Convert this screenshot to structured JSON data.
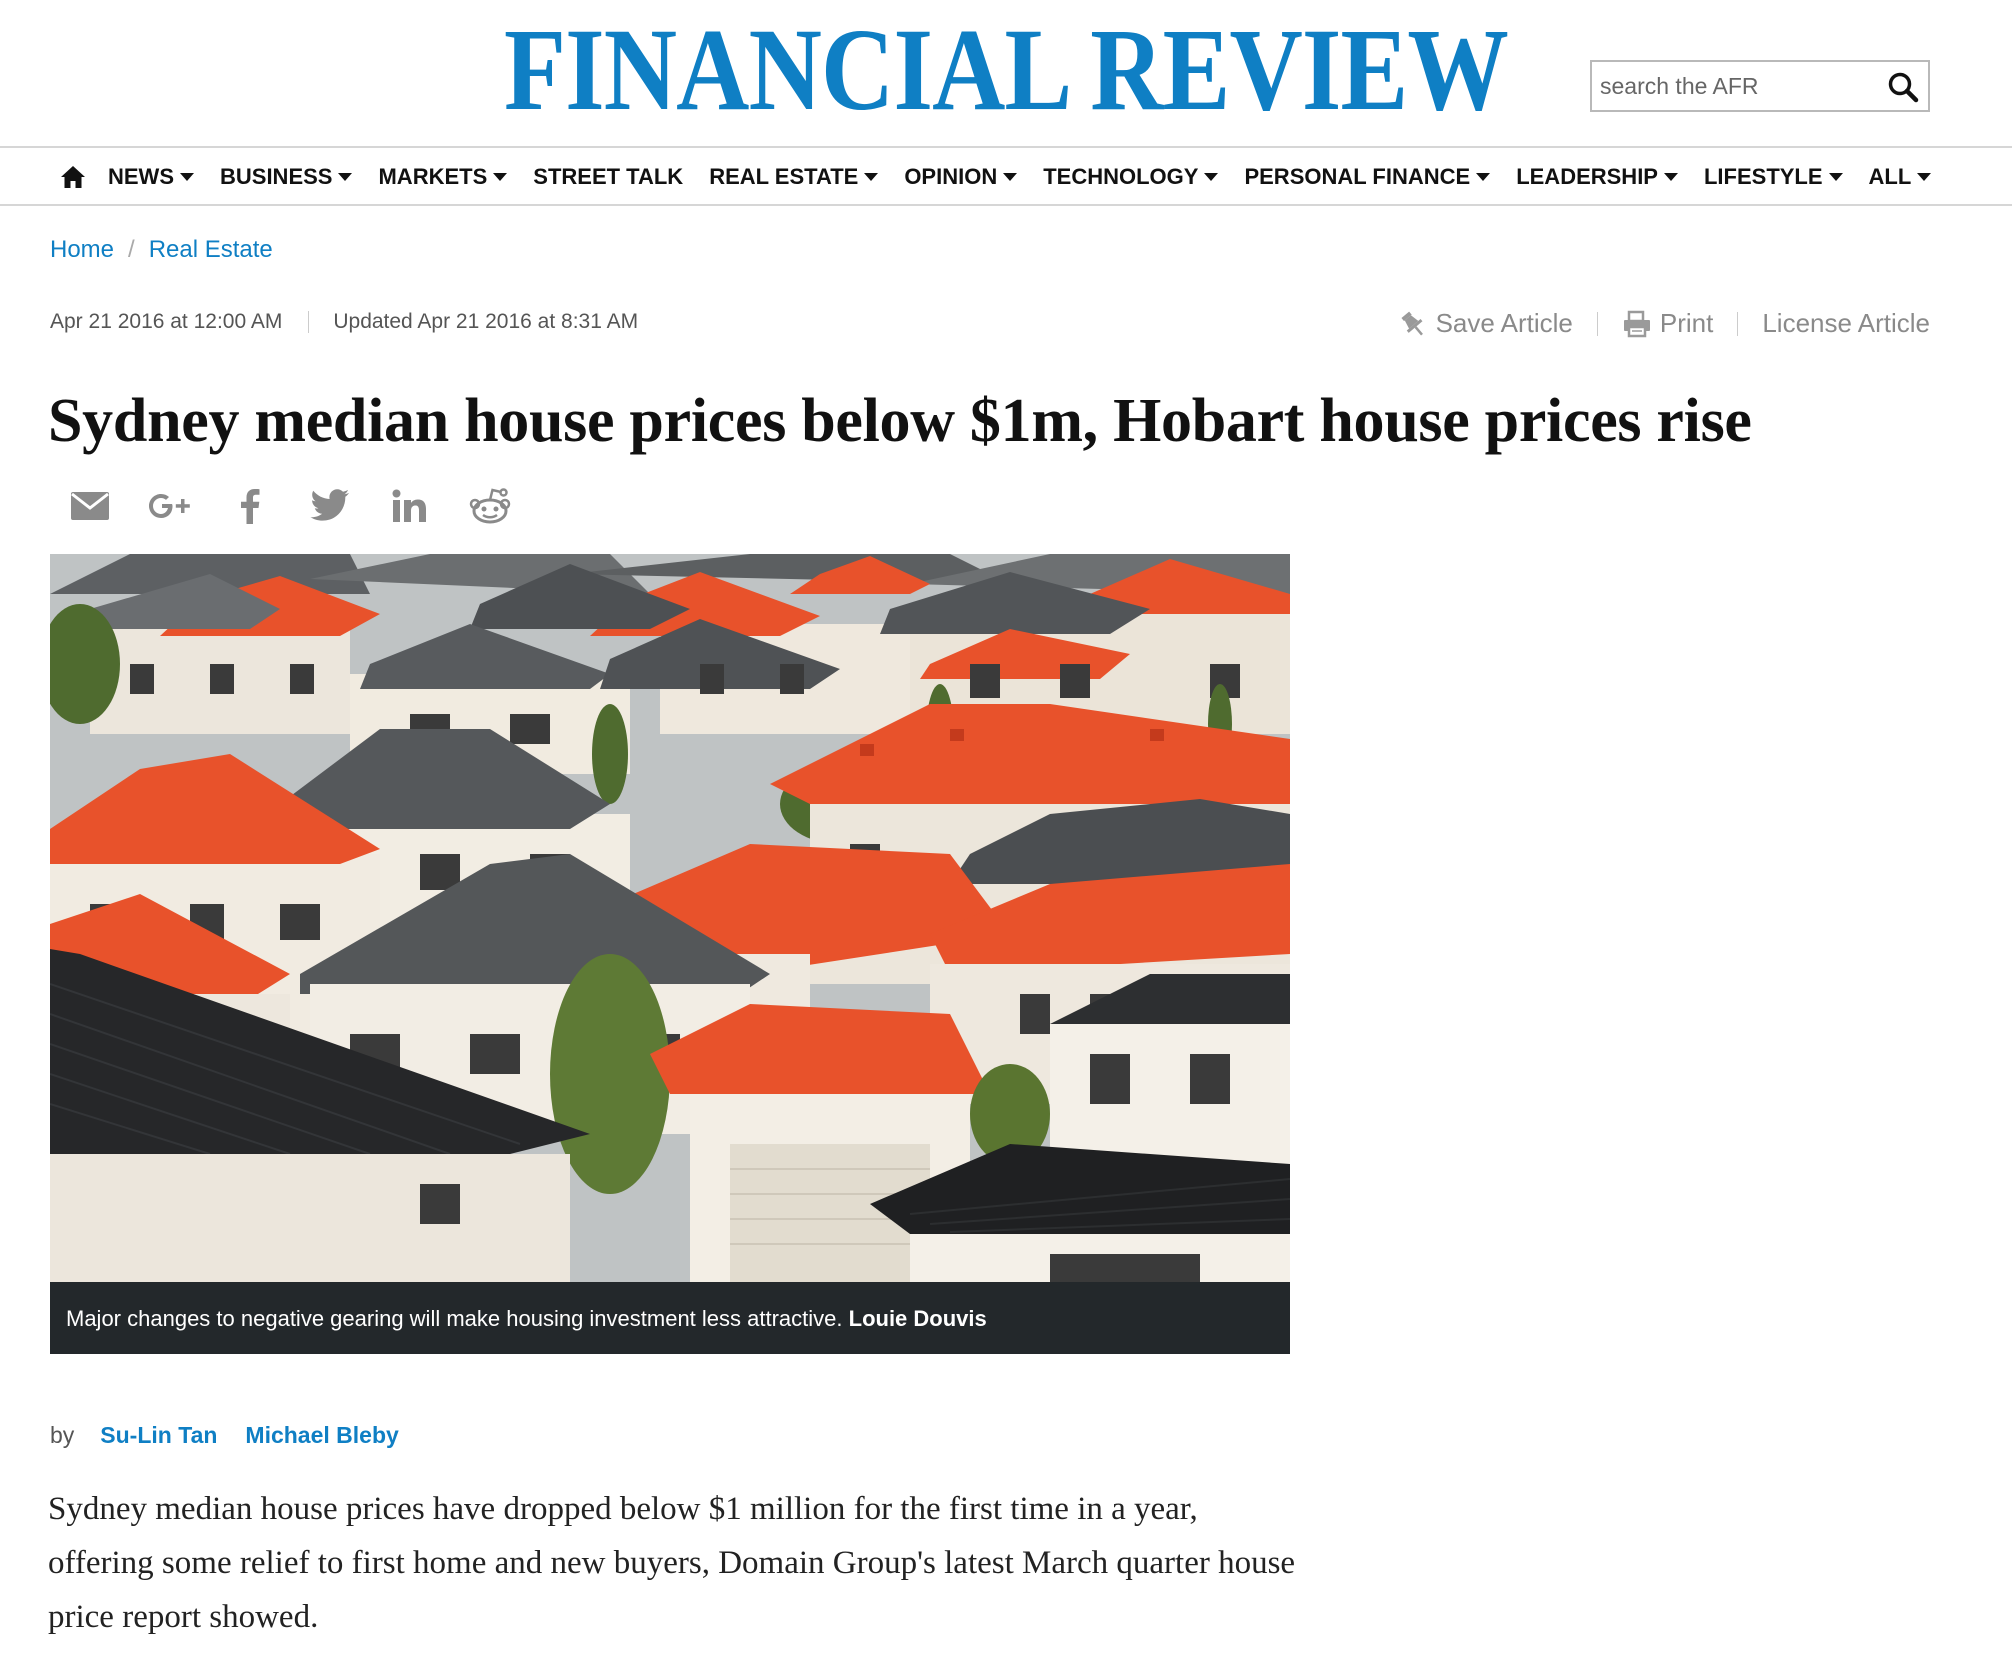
{
  "masthead": {
    "logo": "FINANCIAL REVIEW",
    "search_placeholder": "search the AFR"
  },
  "nav": {
    "items": [
      {
        "label": "NEWS",
        "dropdown": true
      },
      {
        "label": "BUSINESS",
        "dropdown": true
      },
      {
        "label": "MARKETS",
        "dropdown": true
      },
      {
        "label": "STREET TALK",
        "dropdown": false
      },
      {
        "label": "REAL ESTATE",
        "dropdown": true
      },
      {
        "label": "OPINION",
        "dropdown": true
      },
      {
        "label": "TECHNOLOGY",
        "dropdown": true
      },
      {
        "label": "PERSONAL FINANCE",
        "dropdown": true
      },
      {
        "label": "LEADERSHIP",
        "dropdown": true
      },
      {
        "label": "LIFESTYLE",
        "dropdown": true
      },
      {
        "label": "ALL",
        "dropdown": true
      }
    ]
  },
  "breadcrumb": {
    "home": "Home",
    "separator": "/",
    "section": "Real Estate"
  },
  "article": {
    "published": "Apr 21 2016 at 12:00 AM",
    "updated": "Updated Apr 21 2016 at 8:31 AM",
    "tools": {
      "save": "Save Article",
      "print": "Print",
      "license": "License Article"
    },
    "headline": "Sydney median house prices below $1m, Hobart house prices rise",
    "caption": {
      "text": "Major changes to negative gearing will make housing investment less attractive.",
      "credit": "Louie Douvis"
    },
    "byline": {
      "by": "by",
      "authors": [
        "Su-Lin Tan",
        "Michael Bleby"
      ]
    },
    "body": "Sydney median house prices have dropped below $1 million for the first time in a year, offering some relief to first home and new buyers, Domain Group's latest  March quarter house price report showed."
  },
  "icons": {
    "home": "home-icon",
    "search": "search-icon",
    "save": "pin-icon",
    "print": "printer-icon",
    "social": [
      "email-icon",
      "google-plus-icon",
      "facebook-icon",
      "twitter-icon",
      "linkedin-icon",
      "reddit-icon"
    ]
  },
  "colors": {
    "brand": "#0f7fc4",
    "caption_bg": "#23282b",
    "roof_orange": "#e8522b",
    "roof_grey": "#5a5a5c"
  }
}
